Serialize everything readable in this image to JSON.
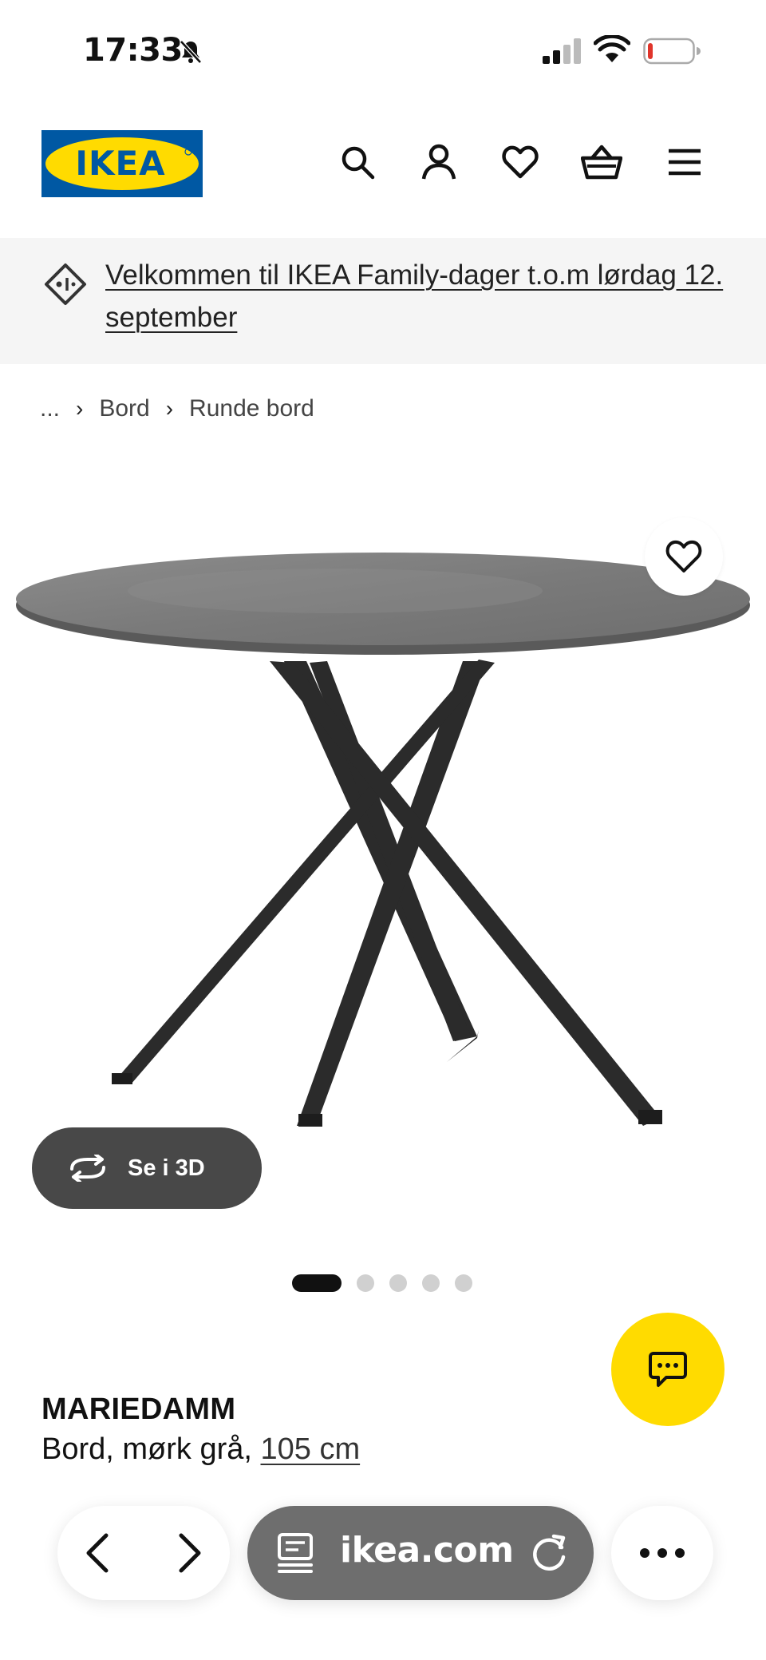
{
  "status_bar": {
    "time": "17:33",
    "mute_icon": "bell-slash-icon",
    "signal_icon": "cellular-signal-icon",
    "wifi_icon": "wifi-icon",
    "battery_icon": "battery-low-icon",
    "battery_level": 0.12,
    "battery_color": "#e0352b"
  },
  "header": {
    "logo_text": "IKEA",
    "logo_colors": {
      "blue": "#0058a3",
      "yellow": "#ffdb00"
    },
    "icons": [
      "search-icon",
      "user-icon",
      "heart-icon",
      "basket-icon",
      "menu-icon"
    ]
  },
  "promo": {
    "icon": "tag-icon",
    "text": "Velkommen til IKEA Family-dager t.o.m lørdag 12. september"
  },
  "breadcrumb": {
    "items": [
      "...",
      "Bord",
      "Runde bord"
    ],
    "separator_icon": "chevron-right-icon"
  },
  "product": {
    "image_alt": "MARIEDAMM round table, dark grey top, black crossed legs",
    "favourite_icon": "heart-icon",
    "view_3d_label": "Se i 3D",
    "view_3d_icon": "rotate-3d-icon",
    "carousel": {
      "count": 5,
      "active": 0
    },
    "name": "MARIEDAMM",
    "desc": "Bord, mørk grå, ",
    "size": "105 cm"
  },
  "chat": {
    "icon": "chat-icon",
    "color": "#ffdb00"
  },
  "browser": {
    "back_icon": "chevron-left-icon",
    "forward_icon": "chevron-right-icon",
    "reader_icon": "reader-icon",
    "url": "ikea.com",
    "reload_icon": "reload-icon",
    "more_icon": "more-icon"
  }
}
